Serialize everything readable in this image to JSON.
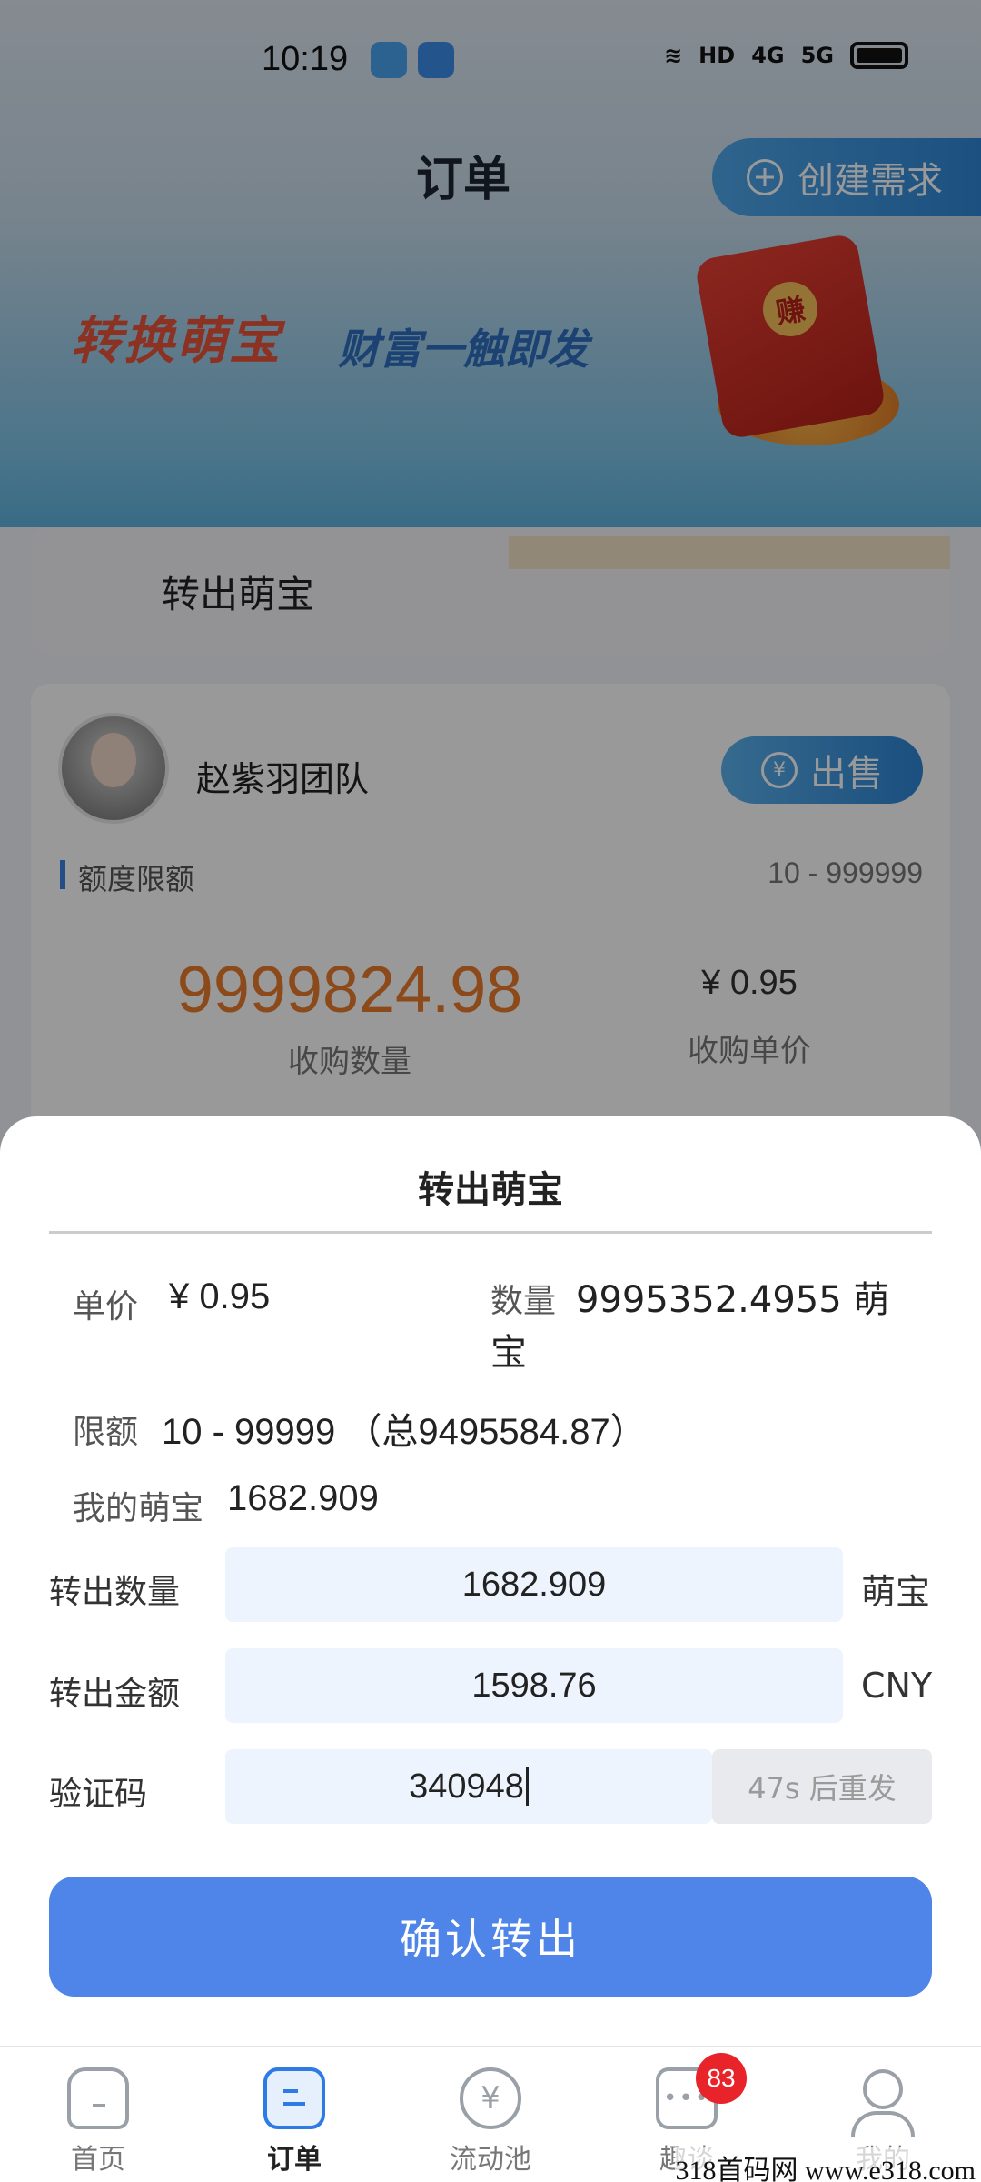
{
  "status_bar": {
    "time": "10:19",
    "hd": "HD",
    "net1": "4G",
    "net2": "5G"
  },
  "header": {
    "title": "订单",
    "create_button": "创建需求"
  },
  "banner": {
    "headline": "转换萌宝",
    "tagline": "财富一触即发",
    "seal": "赚"
  },
  "section_tab": {
    "label": "转出萌宝"
  },
  "card": {
    "team_name": "赵紫羽团队",
    "sell_button": "出售",
    "sell_icon": "¥",
    "quota_label": "额度限额",
    "quota_value": "10 - 999999",
    "buy_quantity": "9999824.98",
    "buy_quantity_label": "收购数量",
    "buy_price": "¥ 0.95",
    "buy_price_label": "收购单价"
  },
  "sheet": {
    "title": "转出萌宝",
    "unit_price_label": "单价",
    "unit_price": "¥ 0.95",
    "quantity_label": "数量",
    "quantity": "9995352.4955 萌宝",
    "limit_label": "限额",
    "limit": "10 - 99999 （总9495584.87）",
    "my_mengbao_label": "我的萌宝",
    "my_mengbao": "1682.909",
    "transfer_qty_label": "转出数量",
    "transfer_qty": "1682.909",
    "transfer_qty_unit": "萌宝",
    "transfer_amount_label": "转出金额",
    "transfer_amount": "1598.76",
    "transfer_amount_unit": "CNY",
    "code_label": "验证码",
    "code": "340948",
    "resend": "47s 后重发",
    "confirm": "确认转出"
  },
  "nav": {
    "items": [
      {
        "label": "首页"
      },
      {
        "label": "订单"
      },
      {
        "label": "流动池",
        "icon_glyph": "¥"
      },
      {
        "label": "趣谈",
        "badge": "83",
        "icon_glyph": "•••"
      },
      {
        "label": "我的"
      }
    ],
    "active_index": 1
  },
  "watermark": "318首码网 www.e318.com"
}
